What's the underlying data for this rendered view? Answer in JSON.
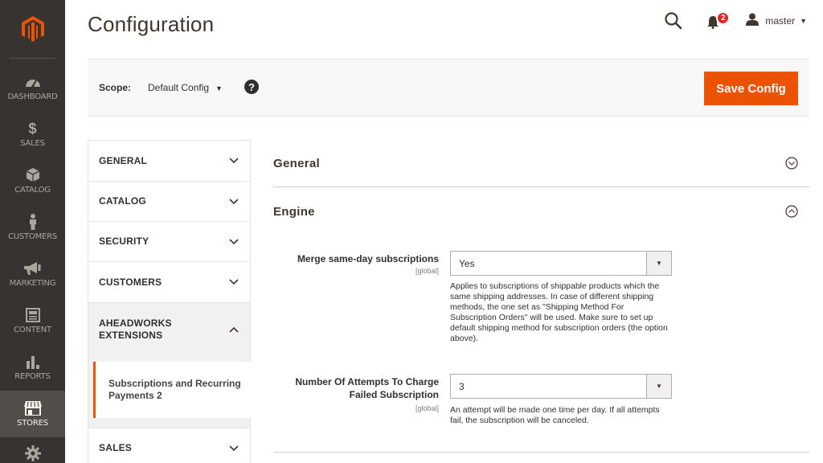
{
  "page": {
    "title": "Configuration"
  },
  "admin_menu": [
    {
      "label": "DASHBOARD",
      "icon": "dashboard-icon"
    },
    {
      "label": "SALES",
      "icon": "dollar-icon"
    },
    {
      "label": "CATALOG",
      "icon": "catalog-box-icon"
    },
    {
      "label": "CUSTOMERS",
      "icon": "customer-icon"
    },
    {
      "label": "MARKETING",
      "icon": "megaphone-icon"
    },
    {
      "label": "CONTENT",
      "icon": "content-icon"
    },
    {
      "label": "REPORTS",
      "icon": "reports-icon"
    },
    {
      "label": "STORES",
      "icon": "stores-icon",
      "active": true
    },
    {
      "label": "",
      "icon": "gear-icon"
    }
  ],
  "header": {
    "notifications_count": "2",
    "user_name": "master",
    "user_caret": "▼"
  },
  "scope": {
    "label": "Scope:",
    "value": "Default Config",
    "caret": "▼",
    "help": "?",
    "save_label": "Save Config"
  },
  "config_tabs": [
    {
      "label": "GENERAL"
    },
    {
      "label": "CATALOG"
    },
    {
      "label": "SECURITY"
    },
    {
      "label": "CUSTOMERS"
    },
    {
      "label": "AHEADWORKS EXTENSIONS",
      "open": true
    },
    {
      "label": "SALES"
    }
  ],
  "config_sub_items": [
    {
      "label": "Subscriptions and Recurring Payments 2",
      "active": true
    }
  ],
  "sections": [
    {
      "title": "General",
      "expanded": false
    },
    {
      "title": "Engine",
      "expanded": true
    }
  ],
  "fields": [
    {
      "label": "Merge same-day subscriptions",
      "scope": "[global]",
      "value": "Yes",
      "note": "Applies to subscriptions of shippable products which the same shipping addresses. In case of different shipping methods, the one set as \"Shipping Method For Subscription Orders\" will be used. Make sure to set up default shipping method for subscription orders (the option above)."
    },
    {
      "label": "Number Of Attempts To Charge Failed Subscription",
      "scope": "[global]",
      "value": "3",
      "note": "An attempt will be made one time per day. If all attempts fail, the subscription will be canceled."
    }
  ],
  "colors": {
    "accent": "#eb5202",
    "sidebar_bg": "#373330",
    "sidebar_active": "#524d49",
    "badge": "#e22626"
  }
}
